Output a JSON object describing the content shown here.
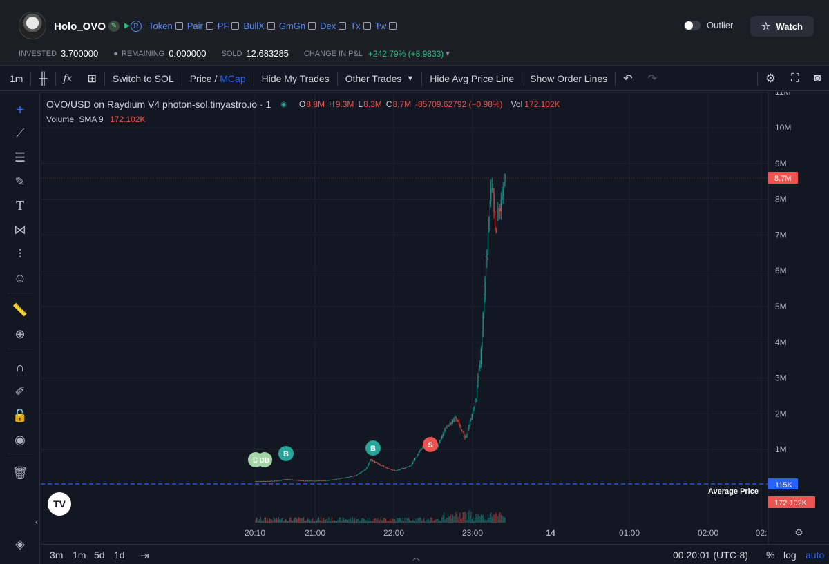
{
  "header": {
    "token_name": "Holo_OVO",
    "links": [
      "Token",
      "Pair",
      "PF",
      "BullX",
      "GmGn",
      "Dex",
      "Tx",
      "Tw"
    ],
    "outlier_label": "Outlier",
    "watch_label": "Watch",
    "stats": {
      "invested_label": "INVESTED",
      "invested_value": "3.700000",
      "remaining_label": "REMAINING",
      "remaining_value": "0.000000",
      "sold_label": "SOLD",
      "sold_value": "12.683285",
      "pnl_label": "CHANGE IN P&L",
      "pnl_value": "+242.79% (+8.9833)"
    }
  },
  "toolbar": {
    "interval": "1m",
    "switch_label": "Switch to SOL",
    "price_label": "Price",
    "mcap_label": "MCap",
    "hide_my_trades": "Hide My Trades",
    "other_trades": "Other Trades",
    "hide_avg": "Hide Avg Price Line",
    "show_order": "Show Order Lines"
  },
  "legend": {
    "pair": "OVO/USD on Raydium V4 photon-sol.tinyastro.io · 1",
    "o": "8.8M",
    "h": "9.3M",
    "l": "8.3M",
    "c": "8.7M",
    "change": "-85709.62792 (−0.98%)",
    "vol": "172.102K",
    "volume_label": "Volume",
    "sma_label": "SMA 9",
    "sma_value": "172.102K"
  },
  "chart_data": {
    "type": "candlestick",
    "y_ticks": [
      "11M",
      "10M",
      "9M",
      "8M",
      "7M",
      "6M",
      "5M",
      "4M",
      "3M",
      "2M",
      "1M"
    ],
    "x_ticks": [
      "20:10",
      "21:00",
      "22:00",
      "23:00",
      "14",
      "01:00",
      "02:00",
      "02:"
    ],
    "last_price_label": "8.7M",
    "avg_price_label": "115K",
    "avg_price_text": "Average Price",
    "volume_label": "172.102K",
    "markers": [
      {
        "label": "D",
        "color": "#a5d6a7",
        "x": "20:10",
        "y": 0.3
      },
      {
        "label": "DB",
        "color": "#a5d6a7",
        "x": "20:20",
        "y": 0.3
      },
      {
        "label": "B",
        "color": "#26a69a",
        "x": "20:30",
        "y": 0.5
      },
      {
        "label": "B",
        "color": "#26a69a",
        "x": "21:50",
        "y": 0.6
      },
      {
        "label": "S",
        "color": "#ef5350",
        "x": "22:30",
        "y": 0.6
      }
    ],
    "price_path_mcap": [
      [
        "20:10",
        0.11
      ],
      [
        "20:30",
        0.12
      ],
      [
        "20:40",
        0.17
      ],
      [
        "21:00",
        0.12
      ],
      [
        "21:20",
        0.13
      ],
      [
        "21:30",
        0.17
      ],
      [
        "21:50",
        0.27
      ],
      [
        "22:00",
        0.45
      ],
      [
        "22:05",
        0.73
      ],
      [
        "22:15",
        0.55
      ],
      [
        "22:30",
        0.4
      ],
      [
        "22:45",
        0.55
      ],
      [
        "22:55",
        1.0
      ],
      [
        "23:05",
        1.35
      ],
      [
        "23:10",
        1.0
      ],
      [
        "23:20",
        1.6
      ],
      [
        "23:30",
        1.9
      ],
      [
        "23:40",
        1.3
      ],
      [
        "23:50",
        2.4
      ],
      [
        "23:55",
        3.6
      ],
      [
        "00:00",
        6.0
      ],
      [
        "00:05",
        8.5
      ],
      [
        "00:10",
        7.2
      ],
      [
        "00:20",
        8.7
      ]
    ]
  },
  "bottom": {
    "ranges": [
      "3m",
      "1m",
      "5d",
      "1d"
    ],
    "time": "00:20:01 (UTC-8)",
    "percent": "%",
    "log": "log",
    "auto": "auto"
  },
  "colors": {
    "up": "#26a69a",
    "down": "#ef5350",
    "accent": "#2962ff",
    "positive": "#26c281"
  }
}
